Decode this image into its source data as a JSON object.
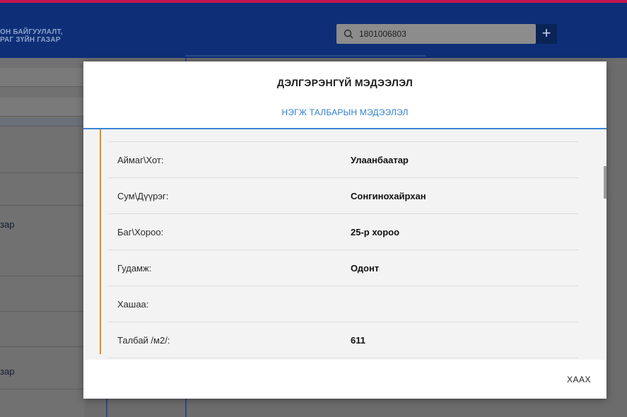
{
  "header": {
    "brand_line1": "ОН БАЙГУУЛАЛТ,",
    "brand_line2": "РАГ ЗҮЙН ГАЗАР",
    "search_value": "1801006803",
    "add_label": "+"
  },
  "left_panel": {
    "label_1": "зар",
    "label_2": "зар"
  },
  "modal": {
    "title": "ДЭЛГЭРЭНГҮЙ МЭДЭЭЛЭЛ",
    "tab": "НЭГЖ ТАЛБАРЫН МЭДЭЭЛЭЛ",
    "rows": [
      {
        "label": "Аймаг\\Хот:",
        "value": "Улаанбаатар"
      },
      {
        "label": "Сум\\Дүүрэг:",
        "value": "Сонгинохайрхан"
      },
      {
        "label": "Баг\\Хороо:",
        "value": "25-р хороо"
      },
      {
        "label": "Гудамж:",
        "value": "Одонт"
      },
      {
        "label": "Хашаа:",
        "value": ""
      },
      {
        "label": "Талбай /м2/:",
        "value": "611"
      }
    ],
    "close_label": "ХААХ"
  },
  "colors": {
    "header_bg": "#0e2f78",
    "top_accent": "#c6164e",
    "tab_blue": "#2f7fd1",
    "row_accent": "#ef8a17"
  }
}
